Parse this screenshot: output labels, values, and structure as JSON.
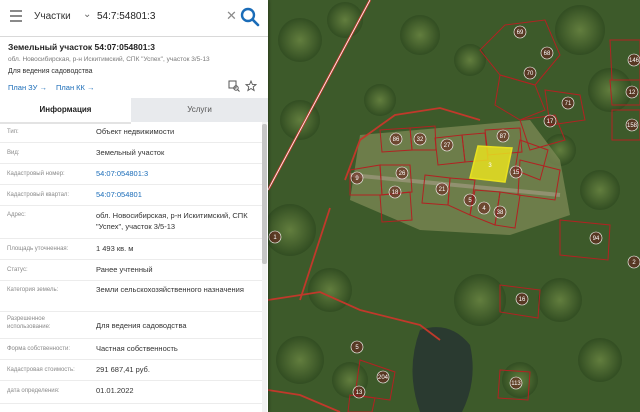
{
  "search": {
    "type": "Участки",
    "query": "54:7:54801:3"
  },
  "object": {
    "title": "Земельный участок 54:07:054801:3",
    "subtitle": "обл. Новосибирская, р-н Искитимский, СПК \"Успех\", участок 3/5-13",
    "usage": "Для ведения садоводства",
    "links": [
      "План ЗУ",
      "План КК"
    ]
  },
  "tabs": [
    "Информация",
    "Услуги"
  ],
  "details": [
    {
      "label": "Тип:",
      "value": "Объект недвижимости"
    },
    {
      "label": "Вид:",
      "value": "Земельный участок"
    },
    {
      "label": "Кадастровый номер:",
      "value": "54:07:054801:3"
    },
    {
      "label": "Кадастровый квартал:",
      "value": "54:07:054801"
    },
    {
      "label": "Адрес:",
      "value": "обл. Новосибирская, р-н Искитимский, СПК \"Успех\", участок 3/5-13"
    },
    {
      "label": "Площадь уточненная:",
      "value": "1 493 кв. м"
    },
    {
      "label": "Статус:",
      "value": "Ранее учтенный"
    },
    {
      "label": "Категория земель:",
      "value": "Земли сельскохозяйственного назначения"
    },
    {
      "label": "Разрешенное использование:",
      "value": "Для ведения садоводства"
    },
    {
      "label": "Форма собственности:",
      "value": "Частная собственность"
    },
    {
      "label": "Кадастровая стоимость:",
      "value": "291 687,41 руб."
    },
    {
      "label": "дата определения:",
      "value": "01.01.2022"
    }
  ],
  "map": {
    "plot_numbers": [
      "69",
      "68",
      "70",
      "71",
      "17",
      "86",
      "32",
      "27",
      "87",
      "15",
      "26",
      "9",
      "18",
      "21",
      "5",
      "4",
      "38",
      "94",
      "16",
      "5",
      "204",
      "13",
      "113",
      "146",
      "12",
      "158",
      "1",
      "2"
    ],
    "selected_plot": "3"
  },
  "colors": {
    "accent": "#1a6cb8",
    "boundary": "#b22222",
    "selected": "#e8e020"
  }
}
